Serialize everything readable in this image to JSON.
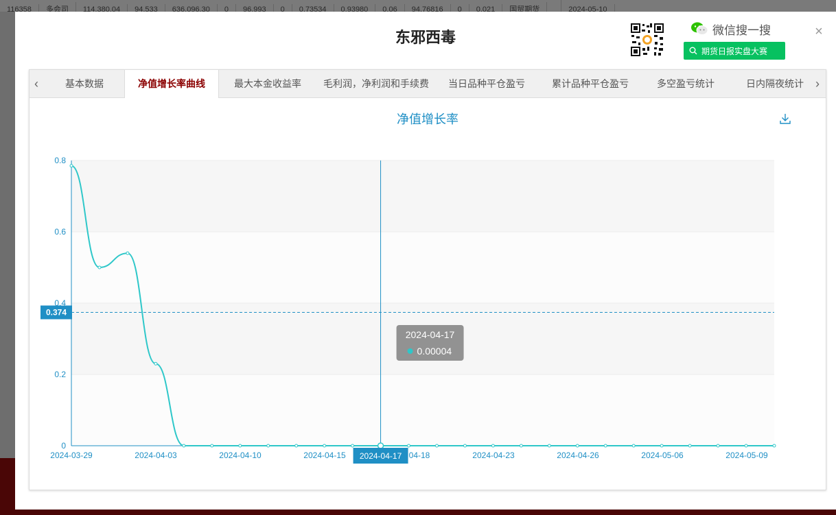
{
  "background": {
    "row_cells": [
      "116358",
      "多会司",
      "114,380.04",
      "94,533",
      "636,096.30",
      "0",
      "96,993",
      "0",
      "0.73534",
      "0.93980",
      "0.06",
      "94.76816",
      "0",
      "0.021",
      "国贸期货",
      "",
      "2024-05-10"
    ]
  },
  "modal": {
    "title": "东邪西毒",
    "close_label": "×",
    "wechat_search_label": "微信搜一搜",
    "promo_button_label": "期货日报实盘大赛"
  },
  "tabs": {
    "prev_arrow": "‹",
    "next_arrow": "›",
    "items": [
      {
        "label": "基本数据",
        "active": false
      },
      {
        "label": "净值增长率曲线",
        "active": true
      },
      {
        "label": "最大本金收益率",
        "active": false
      },
      {
        "label": "毛利润，净利润和手续费",
        "active": false
      },
      {
        "label": "当日品种平仓盈亏",
        "active": false
      },
      {
        "label": "累计品种平仓盈亏",
        "active": false
      },
      {
        "label": "多空盈亏统计",
        "active": false
      },
      {
        "label": "日内隔夜统计",
        "active": false
      }
    ]
  },
  "colors": {
    "series": "#2ec7c9",
    "axis": "#1f8fc5",
    "active_tab": "#8b0000",
    "promo": "#07c160",
    "tooltip_bg": "#8c8c8c"
  },
  "chart_data": {
    "type": "line",
    "title": "净值增长率",
    "xlabel": "",
    "ylabel": "",
    "ylim": [
      0,
      0.8
    ],
    "yticks": [
      "0",
      "0.2",
      "0.4",
      "0.6",
      "0.8"
    ],
    "xticks": [
      "2024-03-29",
      "2024-04-03",
      "2024-04-10",
      "2024-04-15",
      "04-18",
      "2024-04-23",
      "2024-04-26",
      "2024-05-06",
      "2024-05-09"
    ],
    "grid": true,
    "series": [
      {
        "values": [
          0.785,
          0.5,
          0.54,
          0.23,
          0.0,
          0.0,
          0.0,
          0.0,
          0.0,
          0.0,
          0.0,
          4e-05,
          0.0,
          0.0,
          0.0,
          0.0,
          0.0,
          0.0,
          0.0,
          0.0,
          0.0,
          0.0,
          0.0,
          0.0,
          0.0,
          0.0
        ]
      }
    ],
    "crosshair": {
      "x_label": "2024-04-17",
      "y_label": "0.374"
    },
    "tooltip": {
      "date": "2024-04-17",
      "value": "0.00004"
    },
    "download_icon": "download-icon"
  }
}
